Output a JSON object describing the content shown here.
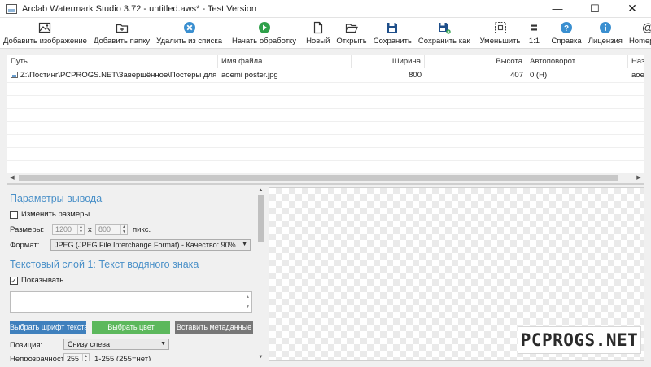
{
  "window": {
    "title": "Arclab Watermark Studio 3.72 - untitled.aws* - Test Version",
    "minimize_glyph": "—",
    "maximize_glyph": "☐",
    "close_glyph": "✕"
  },
  "toolbar": {
    "add_image": "Добавить изображение",
    "add_folder": "Добавить папку",
    "remove_from_list": "Удалить из списка",
    "start_processing": "Начать обработку",
    "new": "Новый",
    "open": "Открыть",
    "save": "Сохранить",
    "save_as": "Сохранить как",
    "zoom_out": "Уменьшить",
    "zoom_one_to_one": "1:1",
    "help": "Справка",
    "license": "Лицензия",
    "homepage": "Homepage",
    "icons": {
      "add_image": "image-icon",
      "add_folder": "folder-icon",
      "remove_from_list": "remove-icon",
      "start_processing": "play-icon",
      "new": "new-file-icon",
      "open": "open-folder-icon",
      "save": "save-icon",
      "save_as": "save-as-icon",
      "zoom_out": "fit-icon",
      "zoom_one_to_one": "equals-icon",
      "help": "help-icon",
      "license": "info-icon",
      "homepage": "at-icon"
    }
  },
  "file_list": {
    "columns": [
      "Путь",
      "Имя файла",
      "Ширина",
      "Высота",
      "Автоповорот",
      "Наз"
    ],
    "rows": [
      {
        "path": "Z:\\Постинг\\PCPROGS.NET\\Завершённое\\Постеры для подб...",
        "filename": "aoemi poster.jpg",
        "width": "800",
        "height": "407",
        "autorotate": "0 (H)",
        "name": "aoe"
      }
    ]
  },
  "output_params": {
    "title": "Параметры вывода",
    "resize_label": "Изменить размеры",
    "resize_checked": false,
    "sizes_label": "Размеры:",
    "width_value": "1200",
    "times_label": "x",
    "height_value": "800",
    "units_label": "пикс.",
    "format_label": "Формат:",
    "format_value": "JPEG (JPEG File Interchange Format) - Качество: 90%"
  },
  "text_layer": {
    "title": "Текстовый слой 1: Текст водяного знака",
    "show_label": "Показывать",
    "show_checked": true,
    "text_value": "",
    "choose_font_button": "Выбрать шрифт текста",
    "choose_color_button": "Выбрать цвет",
    "insert_metadata_button": "Вставить метаданные",
    "position_label": "Позиция:",
    "position_value": "Снизу слева",
    "opacity_label": "Непрозрачность:",
    "opacity_value": "255",
    "opacity_range": "1-255 (255=нет)"
  },
  "colors": {
    "accent_blue": "#4a90c8",
    "font_button": "#3f80bd",
    "color_button": "#5cb85c",
    "metadata_button": "#777777"
  },
  "watermark_text": "PCPROGS.NET"
}
